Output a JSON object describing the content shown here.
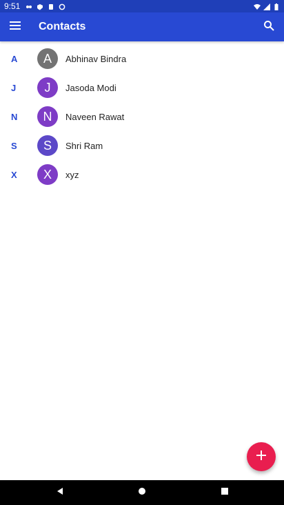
{
  "status_bar": {
    "time": "9:51",
    "left_icons": [
      "fan-icon",
      "shield-icon",
      "clipboard-icon",
      "sync-icon"
    ],
    "right_icons": [
      "wifi-icon",
      "signal-icon",
      "battery-icon"
    ]
  },
  "app_bar": {
    "title": "Contacts",
    "menu_icon": "hamburger-menu-icon",
    "search_icon": "search-icon",
    "background": "#2849d3"
  },
  "contacts": [
    {
      "letter": "A",
      "initial": "A",
      "name": "Abhinav Bindra",
      "color": "#737373"
    },
    {
      "letter": "J",
      "initial": "J",
      "name": "Jasoda Modi",
      "color": "#7e3cc6"
    },
    {
      "letter": "N",
      "initial": "N",
      "name": "Naveen Rawat",
      "color": "#7e3cc6"
    },
    {
      "letter": "S",
      "initial": "S",
      "name": "Shri Ram",
      "color": "#5c48c8"
    },
    {
      "letter": "X",
      "initial": "X",
      "name": "xyz",
      "color": "#7e3cc6"
    }
  ],
  "fab": {
    "icon": "plus-icon",
    "color": "#e91e4f"
  },
  "nav_bar": {
    "icons": [
      "back-icon",
      "home-icon",
      "recents-icon"
    ]
  }
}
